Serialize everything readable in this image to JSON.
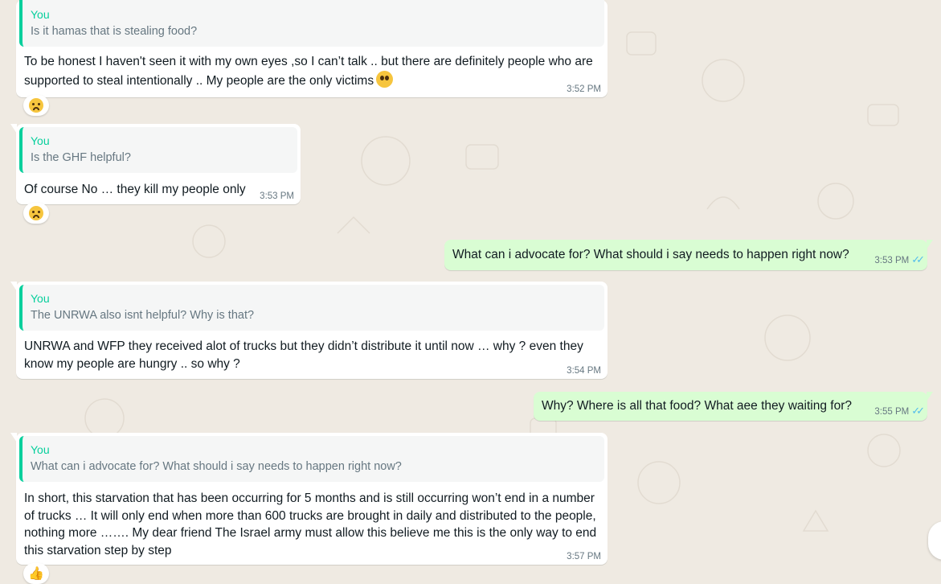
{
  "messages": [
    {
      "quote_author": "You",
      "quote_text": "Is it hamas that is stealing food?",
      "text": "To be honest I haven't seen it with my own eyes ,so I can’t talk .. but there are definitely people who are supported to steal intentionally .. My people are the only victims",
      "inline_emoji": "pleading-face",
      "time": "3:52 PM",
      "reaction": "sad-relieved-face"
    },
    {
      "quote_author": "You",
      "quote_text": "Is the GHF helpful?",
      "text": "Of course No … they kill my people only",
      "time": "3:53 PM",
      "reaction": "sad-relieved-face"
    },
    {
      "text": "What can i advocate for? What should i say needs to happen right now?",
      "time": "3:53 PM",
      "status": "read"
    },
    {
      "quote_author": "You",
      "quote_text": "The UNRWA also isnt helpful? Why is that?",
      "text": "UNRWA and WFP they received alot of trucks but they didn’t distribute it until now … why ? even they know my people are hungry .. so why ?",
      "time": "3:54 PM"
    },
    {
      "text": "Why? Where is all that food? What aee they waiting for?",
      "time": "3:55 PM",
      "status": "read"
    },
    {
      "quote_author": "You",
      "quote_text": "What can i advocate for? What should i say needs to happen right now?",
      "text": "In short, this starvation that has been occurring for 5 months and is still occurring won’t end in a number of trucks … It will only end when more than 600 trucks are brought in daily and distributed to the people, nothing more ……. My dear friend The Israel army must allow this believe me this is the only way to end this starvation step by step",
      "time": "3:57 PM",
      "reaction": "thumbs-up"
    }
  ],
  "icons": {
    "read_ticks": "double-check-icon"
  },
  "colors": {
    "background": "#efeae2",
    "incoming": "#ffffff",
    "outgoing": "#d9fdd3",
    "quote_accent": "#06cf9c",
    "read_ticks": "#53bdeb"
  }
}
